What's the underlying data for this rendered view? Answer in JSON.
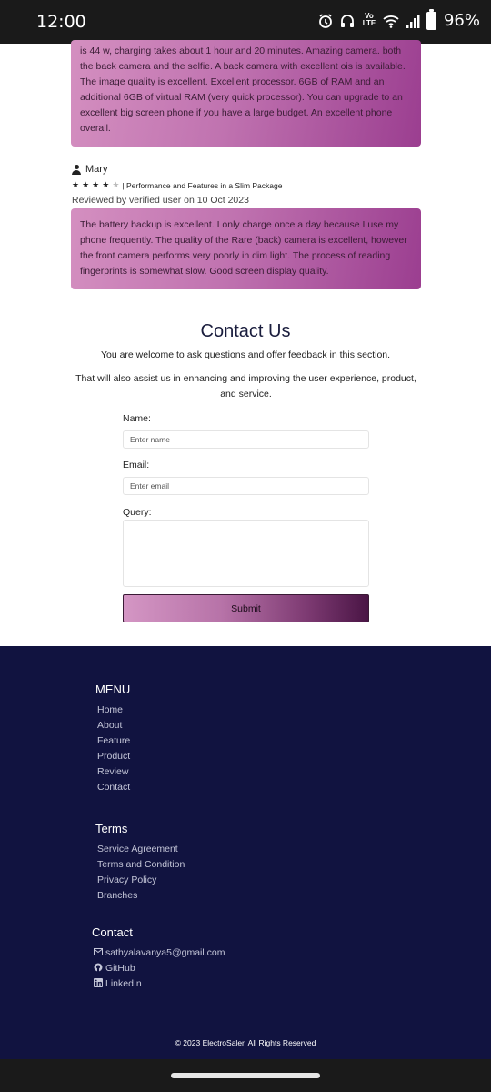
{
  "status_bar": {
    "time": "12:00",
    "lte_label": "Vo LTE",
    "battery_percent": "96%",
    "icons": [
      "alarm-icon",
      "headphones-icon",
      "volte-icon",
      "wifi-icon",
      "signal-icon",
      "battery-icon"
    ]
  },
  "reviews": [
    {
      "text": "is 44 w, charging takes about 1 hour and 20 minutes. Amazing camera. both the back camera and the selfie. A back camera with excellent ois is available. The image quality is excellent. Excellent processor. 6GB of RAM and an additional 6GB of virtual RAM (very quick processor). You can upgrade to an excellent big screen phone if you have a large budget. An excellent phone overall."
    },
    {
      "reviewer": "Mary",
      "stars_filled": 4,
      "stars_total": 5,
      "title": "| Performance and Features in a Slim Package",
      "verified": "Reviewed by verified user on 10 Oct 2023",
      "text": "The battery backup is excellent. I only charge once a day because I use my phone frequently. The quality of the Rare (back) camera is excellent, however the front camera performs very poorly in dim light. The process of reading fingerprints is somewhat slow. Good screen display quality."
    }
  ],
  "contact": {
    "title": "Contact Us",
    "p1": "You are welcome to ask questions and offer feedback in this section.",
    "p2": "That will also assist us in enhancing and improving the user experience, product, and service.",
    "name_label": "Name:",
    "name_placeholder": "Enter name",
    "email_label": "Email:",
    "email_placeholder": "Enter email",
    "query_label": "Query:",
    "submit_label": "Submit"
  },
  "footer": {
    "menu_heading": "MENU",
    "menu_items": [
      "Home",
      "About",
      "Feature",
      "Product",
      "Review",
      "Contact"
    ],
    "terms_heading": "Terms",
    "terms_items": [
      "Service Agreement",
      "Terms and Condition",
      "Privacy Policy",
      "Branches"
    ],
    "contact_heading": "Contact",
    "contact_items": [
      {
        "icon": "envelope-icon",
        "label": "sathyalavanya5@gmail.com"
      },
      {
        "icon": "github-icon",
        "label": "GitHub"
      },
      {
        "icon": "linkedin-icon",
        "label": "LinkedIn"
      }
    ],
    "copyright": "© 2023 ElectroSaler. All Rights Reserved"
  },
  "colors": {
    "footer_bg": "#111340",
    "review_gradient_start": "#d48fc0",
    "review_gradient_end": "#9b3e90"
  }
}
